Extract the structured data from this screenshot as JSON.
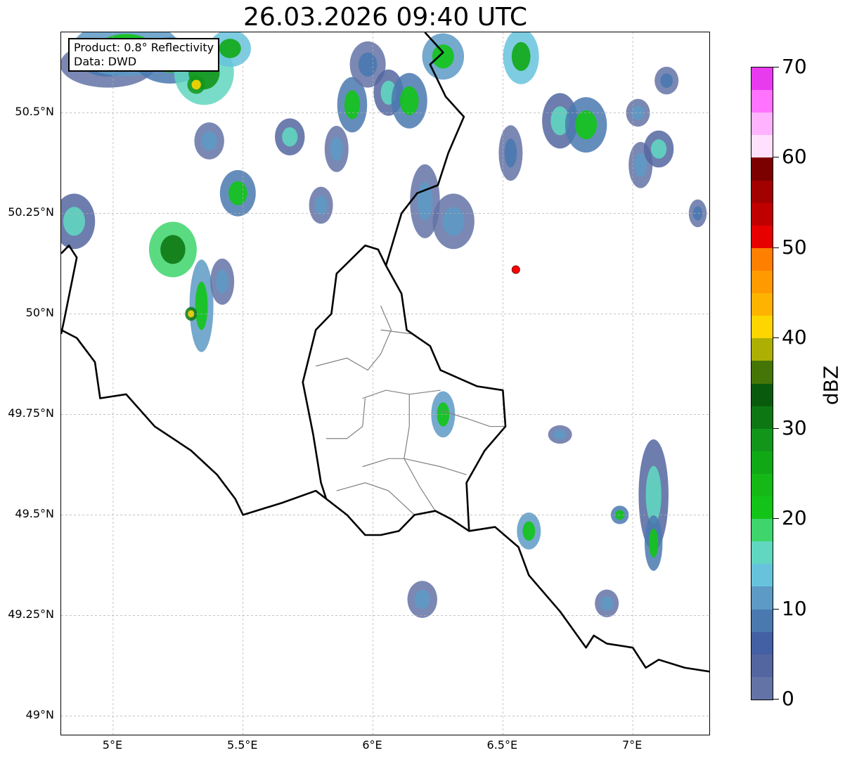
{
  "title": "26.03.2026 09:40 UTC",
  "info_box": {
    "product": "Product: 0.8° Reflectivity",
    "data": "Data: DWD"
  },
  "map": {
    "projection": "PlateCarree",
    "lon_range": [
      4.8,
      7.3
    ],
    "lat_range": [
      48.95,
      50.7
    ],
    "gridlines": true,
    "lat_ticks": [
      {
        "value": 50.5,
        "label": "50.5°N"
      },
      {
        "value": 50.25,
        "label": "50.25°N"
      },
      {
        "value": 50.0,
        "label": "50°N"
      },
      {
        "value": 49.75,
        "label": "49.75°N"
      },
      {
        "value": 49.5,
        "label": "49.5°N"
      },
      {
        "value": 49.25,
        "label": "49.25°N"
      },
      {
        "value": 49.0,
        "label": "49°N"
      }
    ],
    "lon_ticks": [
      {
        "value": 5.0,
        "label": "5°E"
      },
      {
        "value": 5.5,
        "label": "5.5°E"
      },
      {
        "value": 6.0,
        "label": "6°E"
      },
      {
        "value": 6.5,
        "label": "6.5°E"
      },
      {
        "value": 7.0,
        "label": "7°E"
      }
    ],
    "radar_site_marker": {
      "lon": 6.55,
      "lat": 50.11,
      "color": "#ff0000"
    },
    "borders": {
      "color": "#000000",
      "west_outline": [
        [
          4.8,
          50.15
        ],
        [
          4.83,
          50.17
        ],
        [
          4.86,
          50.14
        ],
        [
          4.81,
          49.98
        ],
        [
          4.8,
          49.95
        ]
      ],
      "france_belgium": [
        [
          4.8,
          49.96
        ],
        [
          4.86,
          49.94
        ],
        [
          4.93,
          49.88
        ],
        [
          4.95,
          49.79
        ],
        [
          5.05,
          49.8
        ],
        [
          5.16,
          49.72
        ],
        [
          5.3,
          49.66
        ],
        [
          5.4,
          49.6
        ],
        [
          5.47,
          49.54
        ],
        [
          5.5,
          49.5
        ],
        [
          5.65,
          49.53
        ],
        [
          5.78,
          49.56
        ],
        [
          5.82,
          49.54
        ]
      ],
      "luxembourg_outline": [
        [
          5.82,
          49.54
        ],
        [
          5.8,
          49.58
        ],
        [
          5.77,
          49.7
        ],
        [
          5.73,
          49.83
        ],
        [
          5.78,
          49.96
        ],
        [
          5.84,
          50.0
        ],
        [
          5.86,
          50.1
        ],
        [
          5.97,
          50.17
        ],
        [
          6.02,
          50.16
        ],
        [
          6.05,
          50.12
        ],
        [
          6.11,
          50.05
        ],
        [
          6.13,
          49.96
        ],
        [
          6.22,
          49.92
        ],
        [
          6.26,
          49.86
        ],
        [
          6.33,
          49.84
        ],
        [
          6.4,
          49.82
        ],
        [
          6.5,
          49.81
        ],
        [
          6.51,
          49.72
        ],
        [
          6.43,
          49.66
        ],
        [
          6.36,
          49.58
        ],
        [
          6.37,
          49.46
        ],
        [
          6.3,
          49.49
        ],
        [
          6.24,
          49.51
        ],
        [
          6.16,
          49.5
        ],
        [
          6.1,
          49.46
        ],
        [
          6.03,
          49.45
        ],
        [
          5.97,
          49.45
        ],
        [
          5.9,
          49.5
        ],
        [
          5.82,
          49.54
        ]
      ],
      "belgium_germany": [
        [
          6.05,
          50.12
        ],
        [
          6.11,
          50.25
        ],
        [
          6.17,
          50.3
        ],
        [
          6.25,
          50.32
        ],
        [
          6.29,
          50.4
        ],
        [
          6.35,
          50.49
        ],
        [
          6.28,
          50.54
        ],
        [
          6.22,
          50.62
        ],
        [
          6.27,
          50.65
        ],
        [
          6.2,
          50.7
        ]
      ],
      "germany_france": [
        [
          6.37,
          49.46
        ],
        [
          6.47,
          49.47
        ],
        [
          6.56,
          49.42
        ],
        [
          6.6,
          49.35
        ],
        [
          6.72,
          49.26
        ],
        [
          6.82,
          49.17
        ],
        [
          6.85,
          49.2
        ],
        [
          6.9,
          49.18
        ],
        [
          7.0,
          49.17
        ],
        [
          7.05,
          49.12
        ],
        [
          7.1,
          49.14
        ],
        [
          7.2,
          49.12
        ],
        [
          7.3,
          49.11
        ]
      ]
    },
    "admin_boundaries": {
      "color": "#808080"
    },
    "precip_cells": [
      {
        "lon": 4.98,
        "lat": 50.62,
        "rx": 0.16,
        "ry": 0.05,
        "dbz": 8
      },
      {
        "lon": 5.05,
        "lat": 50.66,
        "rx": 0.18,
        "ry": 0.06,
        "dbz": 22
      },
      {
        "lon": 5.22,
        "lat": 50.63,
        "rx": 0.12,
        "ry": 0.05,
        "dbz": 20
      },
      {
        "lon": 5.35,
        "lat": 50.6,
        "rx": 0.1,
        "ry": 0.07,
        "dbz": 28
      },
      {
        "lon": 5.32,
        "lat": 50.57,
        "rx": 0.03,
        "ry": 0.02,
        "dbz": 40
      },
      {
        "lon": 5.45,
        "lat": 50.66,
        "rx": 0.07,
        "ry": 0.04,
        "dbz": 25
      },
      {
        "lon": 5.23,
        "lat": 50.16,
        "rx": 0.08,
        "ry": 0.06,
        "dbz": 30
      },
      {
        "lon": 4.85,
        "lat": 50.23,
        "rx": 0.07,
        "ry": 0.06,
        "dbz": 15
      },
      {
        "lon": 5.34,
        "lat": 50.02,
        "rx": 0.04,
        "ry": 0.1,
        "dbz": 22
      },
      {
        "lon": 5.3,
        "lat": 50.0,
        "rx": 0.02,
        "ry": 0.015,
        "dbz": 42
      },
      {
        "lon": 5.42,
        "lat": 50.08,
        "rx": 0.04,
        "ry": 0.05,
        "dbz": 12
      },
      {
        "lon": 5.48,
        "lat": 50.3,
        "rx": 0.06,
        "ry": 0.05,
        "dbz": 20
      },
      {
        "lon": 5.37,
        "lat": 50.43,
        "rx": 0.05,
        "ry": 0.04,
        "dbz": 10
      },
      {
        "lon": 5.68,
        "lat": 50.44,
        "rx": 0.05,
        "ry": 0.04,
        "dbz": 16
      },
      {
        "lon": 5.86,
        "lat": 50.41,
        "rx": 0.04,
        "ry": 0.05,
        "dbz": 10
      },
      {
        "lon": 5.92,
        "lat": 50.52,
        "rx": 0.05,
        "ry": 0.06,
        "dbz": 20
      },
      {
        "lon": 5.98,
        "lat": 50.62,
        "rx": 0.06,
        "ry": 0.05,
        "dbz": 8
      },
      {
        "lon": 5.8,
        "lat": 50.27,
        "rx": 0.04,
        "ry": 0.04,
        "dbz": 12
      },
      {
        "lon": 6.06,
        "lat": 50.55,
        "rx": 0.05,
        "ry": 0.05,
        "dbz": 15
      },
      {
        "lon": 6.14,
        "lat": 50.53,
        "rx": 0.06,
        "ry": 0.06,
        "dbz": 20
      },
      {
        "lon": 6.27,
        "lat": 50.64,
        "rx": 0.07,
        "ry": 0.05,
        "dbz": 22
      },
      {
        "lon": 6.57,
        "lat": 50.64,
        "rx": 0.06,
        "ry": 0.06,
        "dbz": 25
      },
      {
        "lon": 6.2,
        "lat": 50.28,
        "rx": 0.05,
        "ry": 0.08,
        "dbz": 12
      },
      {
        "lon": 6.31,
        "lat": 50.23,
        "rx": 0.07,
        "ry": 0.06,
        "dbz": 10
      },
      {
        "lon": 6.53,
        "lat": 50.4,
        "rx": 0.04,
        "ry": 0.06,
        "dbz": 8
      },
      {
        "lon": 6.72,
        "lat": 50.48,
        "rx": 0.06,
        "ry": 0.06,
        "dbz": 15
      },
      {
        "lon": 6.82,
        "lat": 50.47,
        "rx": 0.07,
        "ry": 0.06,
        "dbz": 20
      },
      {
        "lon": 7.02,
        "lat": 50.5,
        "rx": 0.04,
        "ry": 0.03,
        "dbz": 10
      },
      {
        "lon": 7.03,
        "lat": 50.37,
        "rx": 0.04,
        "ry": 0.05,
        "dbz": 12
      },
      {
        "lon": 7.1,
        "lat": 50.41,
        "rx": 0.05,
        "ry": 0.04,
        "dbz": 15
      },
      {
        "lon": 7.25,
        "lat": 50.25,
        "rx": 0.03,
        "ry": 0.03,
        "dbz": 8
      },
      {
        "lon": 6.27,
        "lat": 49.75,
        "rx": 0.04,
        "ry": 0.05,
        "dbz": 22
      },
      {
        "lon": 6.6,
        "lat": 49.46,
        "rx": 0.04,
        "ry": 0.04,
        "dbz": 22
      },
      {
        "lon": 6.95,
        "lat": 49.5,
        "rx": 0.03,
        "ry": 0.02,
        "dbz": 20
      },
      {
        "lon": 7.08,
        "lat": 49.55,
        "rx": 0.05,
        "ry": 0.12,
        "dbz": 15
      },
      {
        "lon": 7.08,
        "lat": 49.43,
        "rx": 0.03,
        "ry": 0.06,
        "dbz": 20
      },
      {
        "lon": 6.19,
        "lat": 49.29,
        "rx": 0.05,
        "ry": 0.04,
        "dbz": 12
      },
      {
        "lon": 6.9,
        "lat": 49.28,
        "rx": 0.04,
        "ry": 0.03,
        "dbz": 10
      },
      {
        "lon": 6.72,
        "lat": 49.7,
        "rx": 0.04,
        "ry": 0.02,
        "dbz": 10
      },
      {
        "lon": 7.13,
        "lat": 50.58,
        "rx": 0.04,
        "ry": 0.03,
        "dbz": 8
      }
    ]
  },
  "colorbar": {
    "label": "dBZ",
    "min": 0,
    "max": 70,
    "ticks": [
      {
        "value": 0,
        "label": "0"
      },
      {
        "value": 10,
        "label": "10"
      },
      {
        "value": 20,
        "label": "20"
      },
      {
        "value": 30,
        "label": "30"
      },
      {
        "value": 40,
        "label": "40"
      },
      {
        "value": 50,
        "label": "50"
      },
      {
        "value": 60,
        "label": "60"
      },
      {
        "value": 70,
        "label": "70"
      }
    ],
    "colors": [
      "#6473a6",
      "#5466a0",
      "#4460a4",
      "#4a79b0",
      "#5d9ac4",
      "#67c3dc",
      "#61d6c0",
      "#3dd56c",
      "#12c418",
      "#14b916",
      "#11a816",
      "#12961a",
      "#0d7813",
      "#0a5a0d",
      "#457507",
      "#adb003",
      "#fdd600",
      "#feb300",
      "#ff9a00",
      "#ff7f00",
      "#e60000",
      "#c00000",
      "#a30000",
      "#7c0000",
      "#ffe0fd",
      "#ffb3ff",
      "#ff73ff",
      "#e83aee"
    ]
  }
}
